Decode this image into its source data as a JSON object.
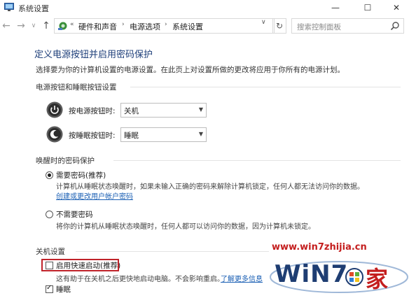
{
  "window": {
    "title": "系统设置",
    "min_glyph": "—",
    "max_glyph": "☐",
    "close_glyph": "✕"
  },
  "nav": {
    "back_glyph": "←",
    "forward_glyph": "→",
    "dropdown_glyph": "∨",
    "up_glyph": "↑",
    "breadcrumb_prefix": "«",
    "breadcrumb": [
      "硬件和声音",
      "电源选项",
      "系统设置"
    ],
    "breadcrumb_sep": "›",
    "refresh_glyph": "↻",
    "search_placeholder": "搜索控制面板"
  },
  "page": {
    "title": "定义电源按钮并启用密码保护",
    "intro": "选择要为你的计算机设置的电源设置。在此页上对设置所做的更改将应用于你所有的电源计划。"
  },
  "power_buttons": {
    "heading": "电源按钮和睡眠按钮设置",
    "power_label": "按电源按钮时:",
    "power_value": "关机",
    "sleep_label": "按睡眠按钮时:",
    "sleep_value": "睡眠"
  },
  "wake_password": {
    "heading": "唤醒时的密码保护",
    "option1_label": "需要密码(推荐)",
    "option1_desc": "计算机从睡眠状态唤醒时，如果未输入正确的密码来解除计算机锁定，任何人都无法访问你的数据。",
    "option1_link": "创建或更改用户帐户密码",
    "option2_label": "不需要密码",
    "option2_desc": "将你的计算机从睡眠状态唤醒时，任何人都可以访问你的数据，因为计算机未锁定。"
  },
  "shutdown": {
    "heading": "关机设置",
    "fast_startup_label": "启用快速启动(推荐)",
    "fast_startup_checked": false,
    "fast_startup_desc": "这有助于在关机之后更快地启动电脑。不会影响重启。",
    "fast_startup_link": "了解更多信息",
    "sleep_label": "睡眠",
    "sleep_checked": true
  },
  "watermark": {
    "url": "www.win7zhijia.cn",
    "logo_text": "WiN7",
    "logo_char": "家"
  },
  "colors": {
    "heading_blue": "#1e3f7a",
    "link_blue": "#1a5fb4",
    "highlight_red": "#c0232a"
  }
}
